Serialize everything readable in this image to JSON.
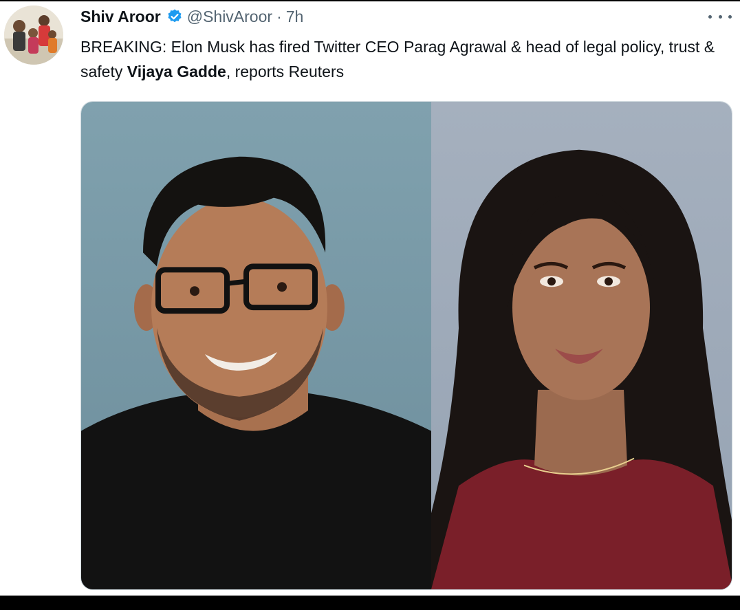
{
  "tweet": {
    "author": {
      "display_name": "Shiv Aroor",
      "handle": "@ShivAroor",
      "verified": true,
      "avatar_icon": "profile-photo"
    },
    "separator": "·",
    "time": "7h",
    "text": {
      "part1": "BREAKING: Elon Musk has fired Twitter CEO Parag Agrawal & head of legal policy, trust & safety ",
      "bold": "Vijaya Gadde",
      "part2": ", reports Reuters"
    },
    "more_icon": "more-horizontal-icon",
    "media": {
      "count": 2,
      "images": [
        "portrait-photo",
        "portrait-photo"
      ]
    }
  },
  "colors": {
    "text": "#0f1419",
    "secondary": "#536471",
    "verified": "#1d9bf0",
    "left_photo_bg": "#7896a3",
    "right_photo_bg": "#a1adbb"
  }
}
